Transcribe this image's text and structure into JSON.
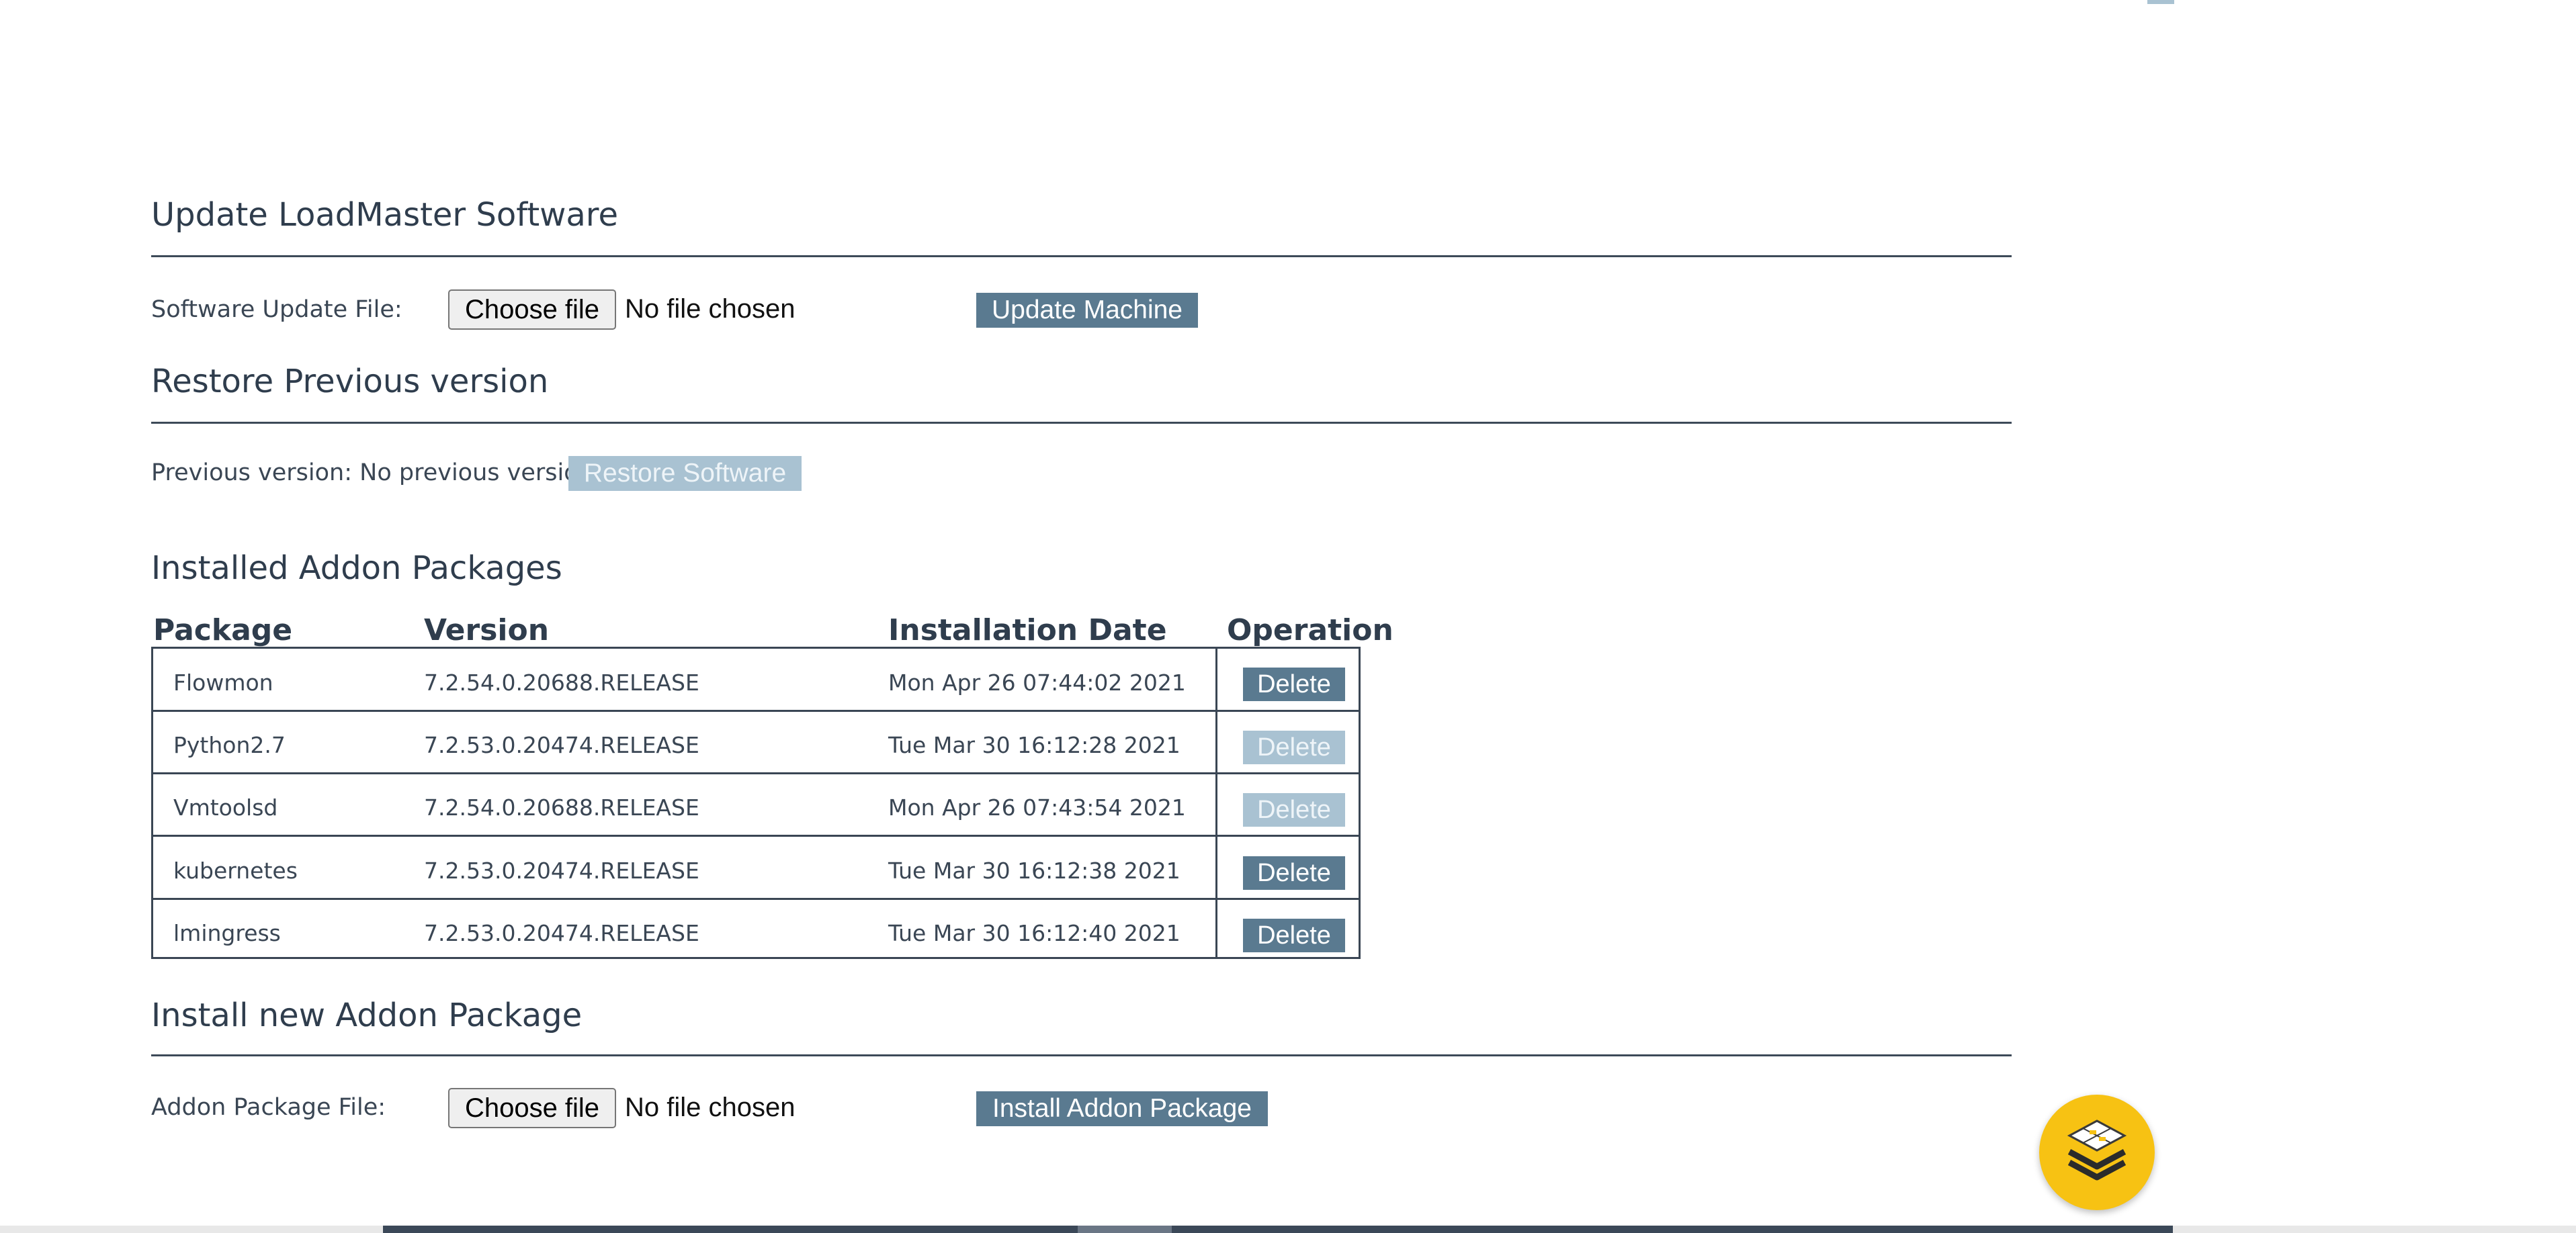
{
  "update_section": {
    "title": "Update LoadMaster Software",
    "file_label": "Software Update File:",
    "choose_file_label": "Choose file",
    "file_status": "No file chosen",
    "update_button_label": "Update Machine"
  },
  "restore_section": {
    "title": "Restore Previous version",
    "previous_version_label": "Previous version: No previous version",
    "restore_button_label": "Restore Software"
  },
  "addons_section": {
    "title": "Installed Addon Packages",
    "columns": [
      "Package",
      "Version",
      "Installation Date",
      "Operation"
    ],
    "rows": [
      {
        "package": "Flowmon",
        "version": "7.2.54.0.20688.RELEASE",
        "date": "Mon Apr 26 07:44:02 2021",
        "operation": "Delete",
        "enabled": true
      },
      {
        "package": "Python2.7",
        "version": "7.2.53.0.20474.RELEASE",
        "date": "Tue Mar 30 16:12:28 2021",
        "operation": "Delete",
        "enabled": false
      },
      {
        "package": "Vmtoolsd",
        "version": "7.2.54.0.20688.RELEASE",
        "date": "Mon Apr 26 07:43:54 2021",
        "operation": "Delete",
        "enabled": false
      },
      {
        "package": "kubernetes",
        "version": "7.2.53.0.20474.RELEASE",
        "date": "Tue Mar 30 16:12:38 2021",
        "operation": "Delete",
        "enabled": true
      },
      {
        "package": "lmingress",
        "version": "7.2.53.0.20474.RELEASE",
        "date": "Tue Mar 30 16:12:40 2021",
        "operation": "Delete",
        "enabled": true
      }
    ]
  },
  "install_section": {
    "title": "Install new Addon Package",
    "file_label": "Addon Package File:",
    "choose_file_label": "Choose file",
    "file_status": "No file chosen",
    "install_button_label": "Install Addon Package"
  },
  "widget": {
    "icon": "stacked-layers-icon"
  },
  "colors": {
    "button_primary": "#5a7a90",
    "button_disabled": "#a9c2d2",
    "divider": "#3d4a58",
    "widget_yellow": "#f7c213"
  }
}
